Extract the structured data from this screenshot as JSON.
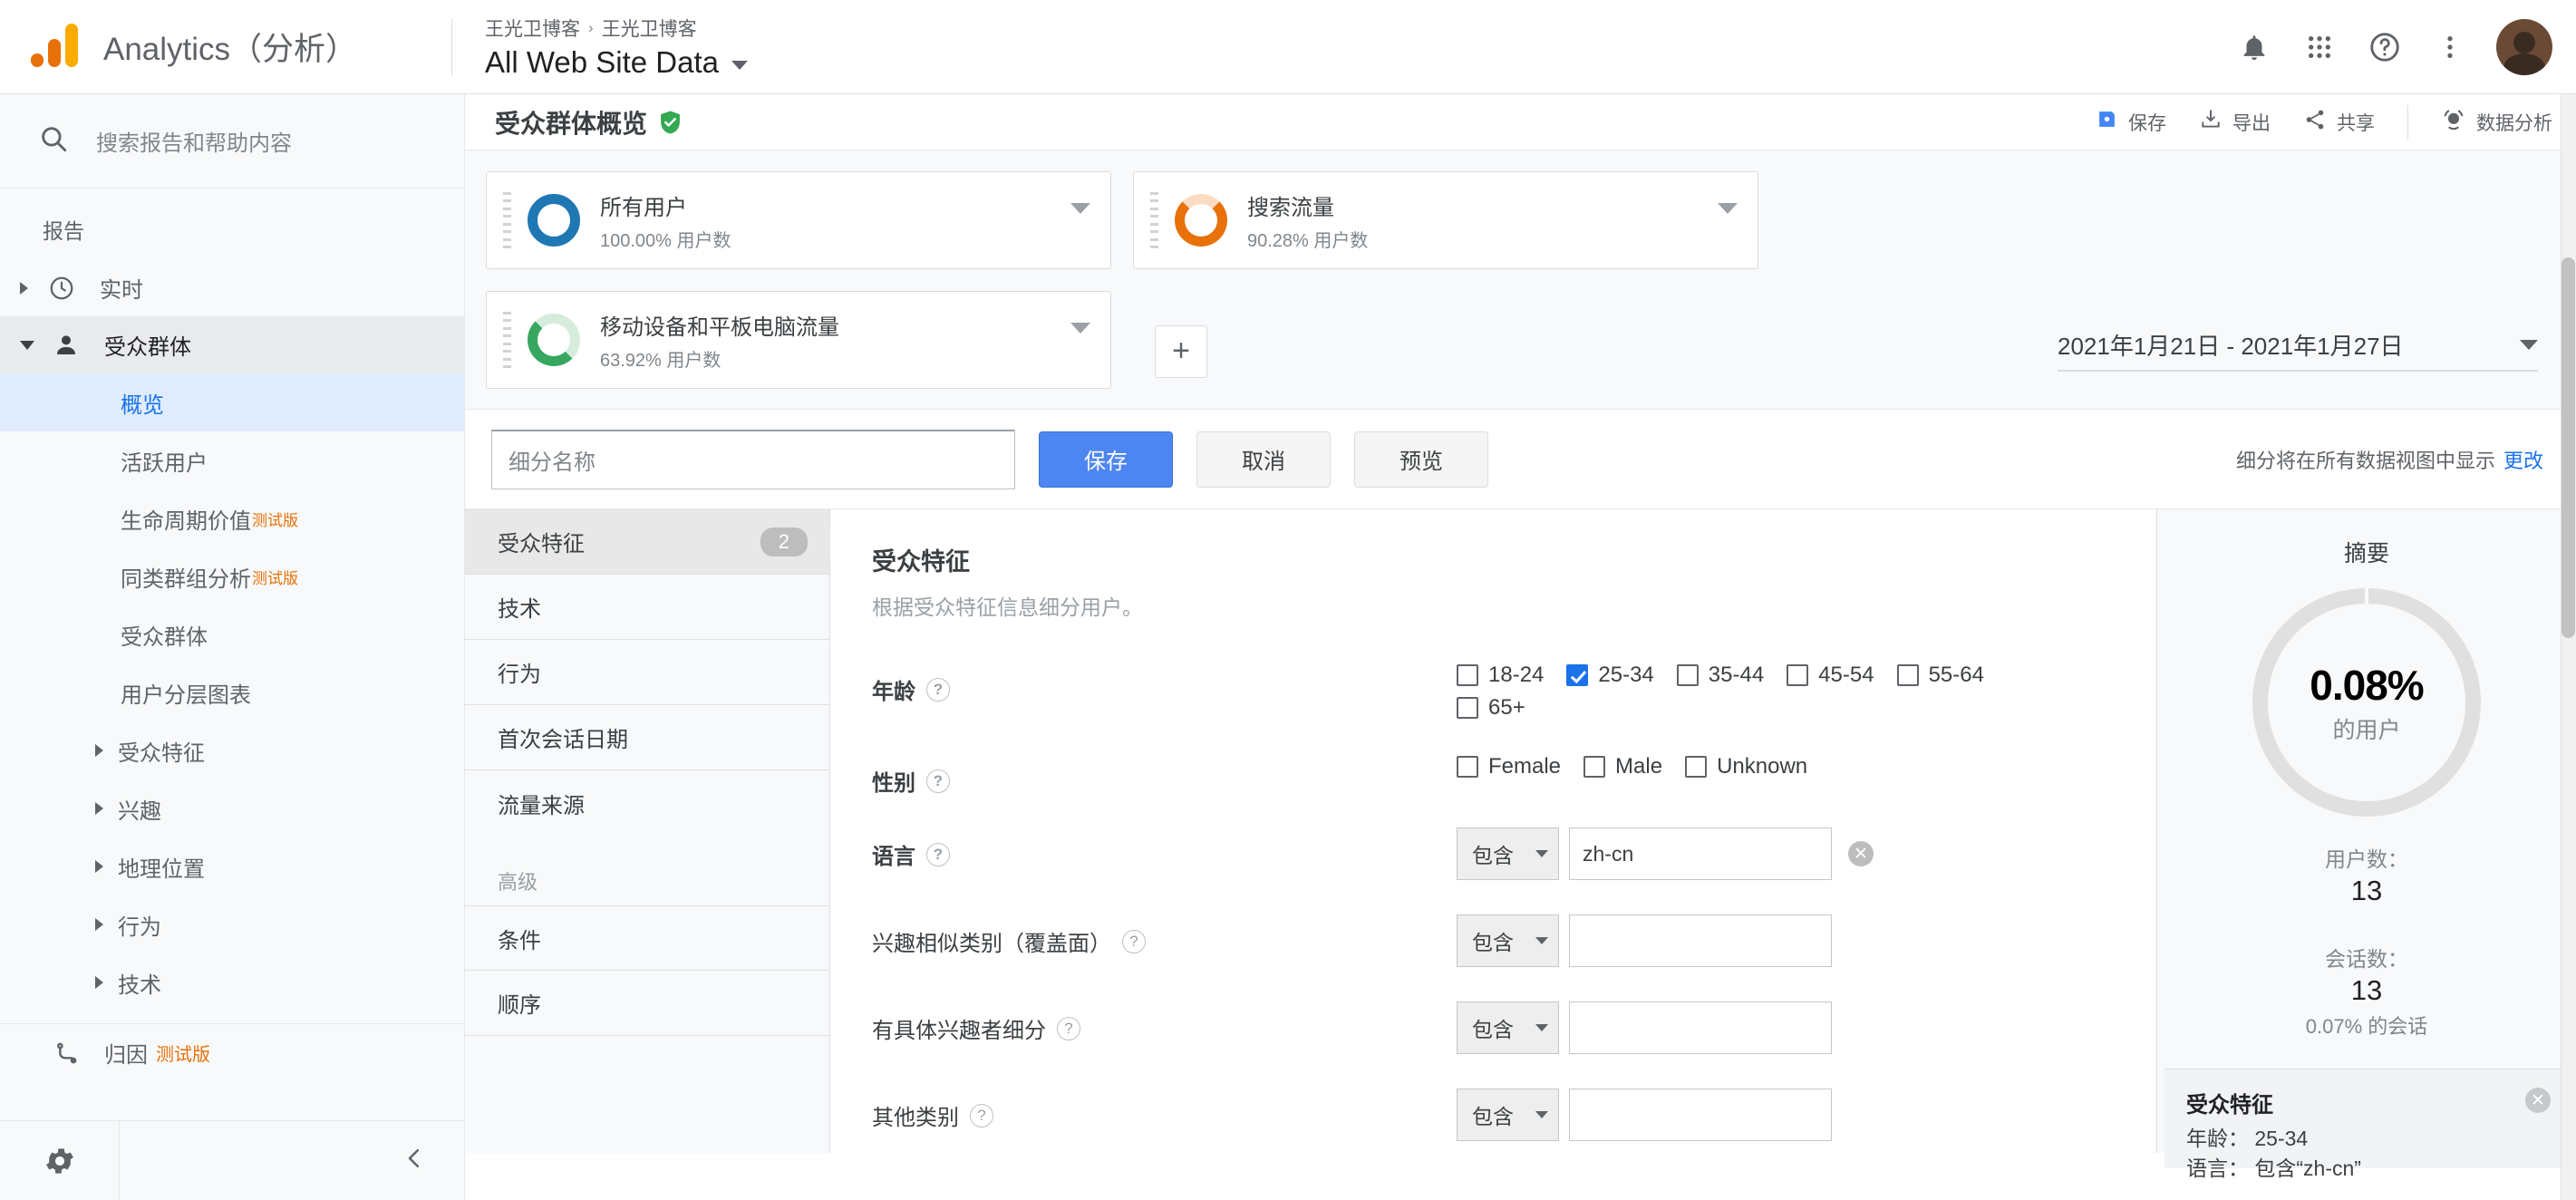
{
  "topbar": {
    "brand": "Analytics（分析）",
    "breadcrumb": [
      "王光卫博客",
      "王光卫博客"
    ],
    "breadcrumb_sep": "›",
    "view_title": "All Web Site Data",
    "icons": {
      "bell": "notifications-icon",
      "apps": "apps-grid-icon",
      "help": "help-icon",
      "more": "more-vert-icon",
      "avatar": "user-avatar"
    }
  },
  "sidebar": {
    "search_placeholder": "搜索报告和帮助内容",
    "section_label": "报告",
    "realtime": "实时",
    "audience": "受众群体",
    "items": [
      {
        "label": "概览",
        "selected": true,
        "beta": ""
      },
      {
        "label": "活跃用户",
        "selected": false,
        "beta": ""
      },
      {
        "label": "生命周期价值",
        "selected": false,
        "beta": "测试版"
      },
      {
        "label": "同类群组分析",
        "selected": false,
        "beta": "测试版"
      },
      {
        "label": "受众群体",
        "selected": false,
        "beta": ""
      },
      {
        "label": "用户分层图表",
        "selected": false,
        "beta": ""
      }
    ],
    "expandables": [
      "受众特征",
      "兴趣",
      "地理位置",
      "行为",
      "技术"
    ],
    "attribution": "归因",
    "attribution_beta": "测试版",
    "gear": "settings-gear-icon",
    "collapse": "collapse-sidebar-icon"
  },
  "report": {
    "title": "受众群体概览",
    "verified_icon": "verified-shield-icon",
    "actions": [
      {
        "label": "保存",
        "icon": "save-icon"
      },
      {
        "label": "导出",
        "icon": "download-icon"
      },
      {
        "label": "共享",
        "icon": "share-icon"
      },
      {
        "label": "数据分析",
        "icon": "insights-icon"
      }
    ],
    "date_range": "2021年1月21日 - 2021年1月27日"
  },
  "segments": {
    "cards": [
      {
        "name": "所有用户",
        "sub": "100.00% 用户数",
        "color": "#1f78b4"
      },
      {
        "name": "搜索流量",
        "sub": "90.28% 用户数",
        "color": "#e8710a"
      },
      {
        "name": "移动设备和平板电脑流量",
        "sub": "63.92% 用户数",
        "color": "#37a760"
      }
    ],
    "add_label": "+"
  },
  "builder": {
    "name_placeholder": "细分名称",
    "save_label": "保存",
    "cancel_label": "取消",
    "preview_label": "预览",
    "note": "细分将在所有数据视图中显示",
    "note_link": "更改",
    "nav": [
      {
        "label": "受众特征",
        "count": "2",
        "active": true
      },
      {
        "label": "技术",
        "count": "",
        "active": false
      },
      {
        "label": "行为",
        "count": "",
        "active": false
      },
      {
        "label": "首次会话日期",
        "count": "",
        "active": false
      },
      {
        "label": "流量来源",
        "count": "",
        "active": false
      }
    ],
    "nav_group_label": "高级",
    "nav_advanced": [
      {
        "label": "条件",
        "count": "",
        "active": false
      },
      {
        "label": "顺序",
        "count": "",
        "active": false
      }
    ],
    "panel_title": "受众特征",
    "panel_sub": "根据受众特征信息细分用户。",
    "fields": {
      "age": {
        "label": "年龄",
        "options": [
          {
            "label": "18-24",
            "checked": false
          },
          {
            "label": "25-34",
            "checked": true
          },
          {
            "label": "35-44",
            "checked": false
          },
          {
            "label": "45-54",
            "checked": false
          },
          {
            "label": "55-64",
            "checked": false
          },
          {
            "label": "65+",
            "checked": false
          }
        ]
      },
      "gender": {
        "label": "性别",
        "options": [
          {
            "label": "Female",
            "checked": false
          },
          {
            "label": "Male",
            "checked": false
          },
          {
            "label": "Unknown",
            "checked": false
          }
        ]
      },
      "language": {
        "label": "语言",
        "operator": "包含",
        "value": "zh-cn"
      },
      "affinity": {
        "label": "兴趣相似类别（覆盖面）",
        "operator": "包含",
        "value": ""
      },
      "inmarket": {
        "label": "有具体兴趣者细分",
        "operator": "包含",
        "value": ""
      },
      "other": {
        "label": "其他类别",
        "operator": "包含",
        "value": ""
      }
    }
  },
  "summary": {
    "title": "摘要",
    "percent": "0.08%",
    "percent_sub": "的用户",
    "users_label": "用户数：",
    "users_value": "13",
    "sessions_label": "会话数：",
    "sessions_value": "13",
    "sessions_note": "0.07% 的会话",
    "card": {
      "heading": "受众特征",
      "lines": [
        "年龄： 25-34",
        "语言： 包含“zh-cn”"
      ]
    }
  }
}
